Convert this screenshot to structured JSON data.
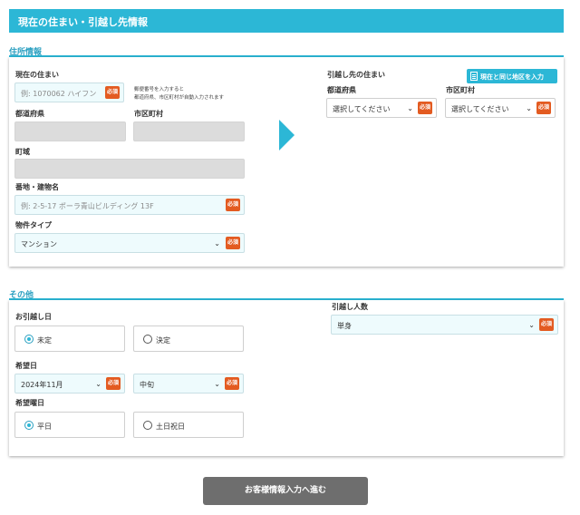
{
  "header": {
    "title": "現在の住まい・引越し先情報"
  },
  "address_section": {
    "title": "住所情報",
    "current": {
      "heading": "現在の住まい",
      "postal_placeholder": "例: 1070062 ハイフン",
      "postal_hint_line1": "郵便番号を入力すると",
      "postal_hint_line2": "都道府県、市区町村が自動入力されます",
      "prefecture_label": "都道府県",
      "city_label": "市区町村",
      "town_label": "町域",
      "street_label": "番地・建物名",
      "street_placeholder": "例: 2-5-17 ポーラ青山ビルディング 13F",
      "property_type_label": "物件タイプ",
      "property_type_value": "マンション"
    },
    "destination": {
      "heading": "引越し先の住まい",
      "same_area_button": "現在と同じ地区を入力",
      "prefecture_label": "都道府県",
      "prefecture_value": "選択してください",
      "city_label": "市区町村",
      "city_value": "選択してください"
    },
    "required_badge": "必須"
  },
  "other_section": {
    "title": "その他",
    "move_date_label": "お引越し日",
    "move_date_options": [
      "未定",
      "決定"
    ],
    "move_date_selected": "未定",
    "desired_date_label": "希望日",
    "desired_month_value": "2024年11月",
    "desired_period_value": "中旬",
    "desired_weekday_label": "希望曜日",
    "weekday_options": [
      "平日",
      "土日祝日"
    ],
    "weekday_selected": "平日",
    "people_label": "引越し人数",
    "people_value": "単身"
  },
  "submit_button": "お客様情報入力へ進む",
  "colors": {
    "accent": "#2cb7d6",
    "required": "#e35b21",
    "submit": "#6e6e6e"
  },
  "icons": {
    "dropdown": "chevron-down-icon",
    "copy": "document-icon",
    "proceed": "arrow-right-icon"
  }
}
